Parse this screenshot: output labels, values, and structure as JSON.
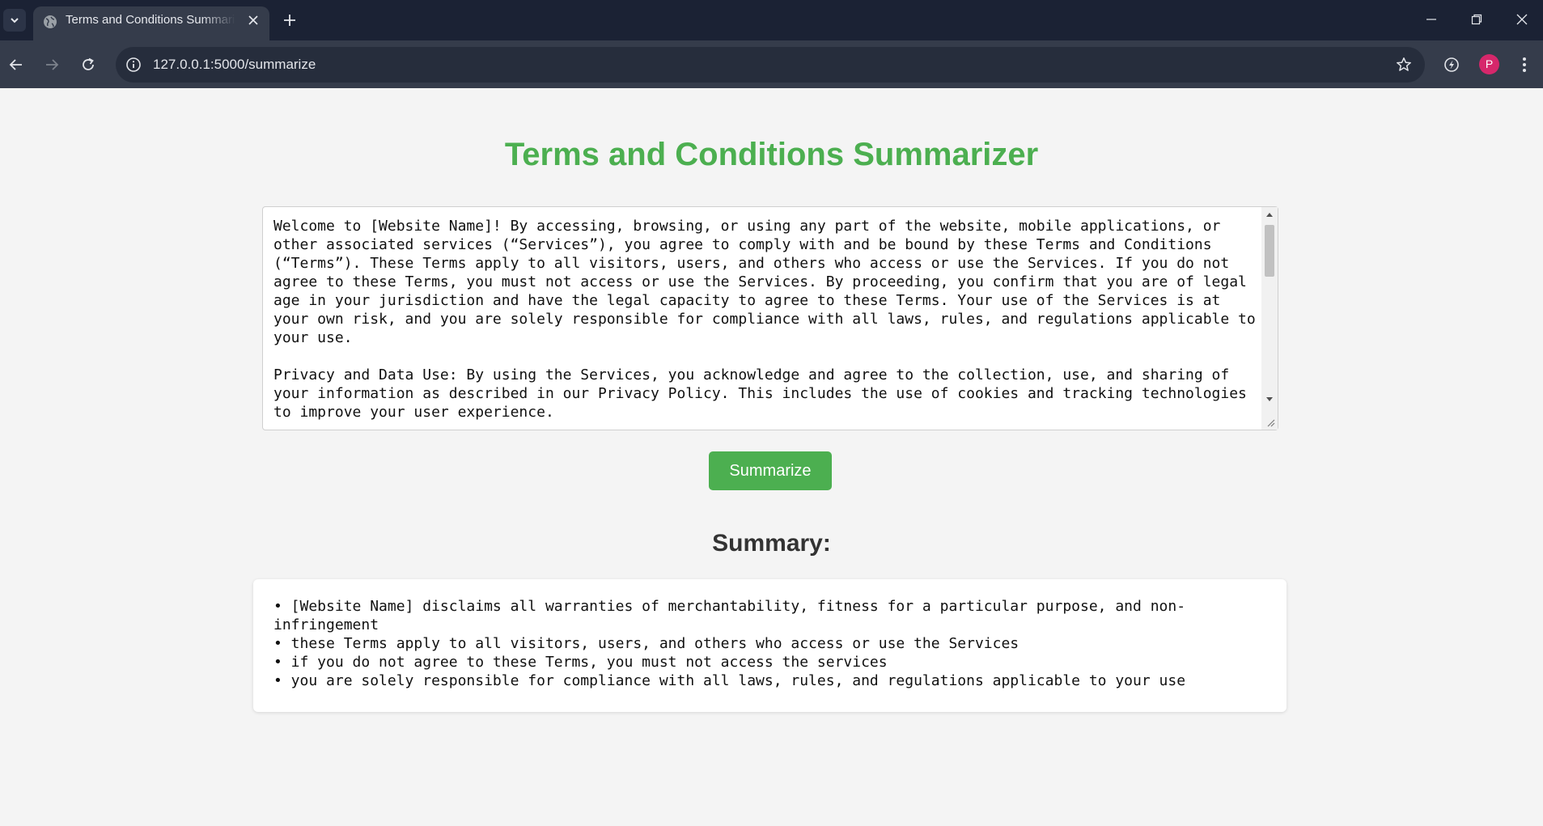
{
  "browser": {
    "tab_title": "Terms and Conditions Summarizer",
    "url": "127.0.0.1:5000/summarize",
    "profile_initial": "P"
  },
  "page": {
    "title": "Terms and Conditions Summarizer",
    "input_text": "Welcome to [Website Name]! By accessing, browsing, or using any part of the website, mobile applications, or other associated services (“Services”), you agree to comply with and be bound by these Terms and Conditions (“Terms”). These Terms apply to all visitors, users, and others who access or use the Services. If you do not agree to these Terms, you must not access or use the Services. By proceeding, you confirm that you are of legal age in your jurisdiction and have the legal capacity to agree to these Terms. Your use of the Services is at your own risk, and you are solely responsible for compliance with all laws, rules, and regulations applicable to your use.\n\nPrivacy and Data Use: By using the Services, you acknowledge and agree to the collection, use, and sharing of your information as described in our Privacy Policy. This includes the use of cookies and tracking technologies to improve your user experience.",
    "summarize_button": "Summarize",
    "summary_heading": "Summary:",
    "summary_bullets": [
      "• [Website Name] disclaims all warranties of merchantability, fitness for a particular purpose, and non-infringement",
      "• these Terms apply to all visitors, users, and others who access or use the Services",
      "• if you do not agree to these Terms, you must not access the services",
      "• you are solely responsible for compliance with all laws, rules, and regulations applicable to your use"
    ]
  },
  "colors": {
    "accent": "#4caf50",
    "chrome_dark": "#1b2234",
    "chrome_toolbar": "#353c4b",
    "avatar": "#d6276b"
  },
  "icons": [
    "tab-search-icon",
    "globe-icon",
    "close-icon",
    "plus-icon",
    "minimize-icon",
    "restore-icon",
    "window-close-icon",
    "back-icon",
    "forward-icon",
    "reload-icon",
    "site-info-icon",
    "bookmark-star-icon",
    "extension-icon",
    "kebab-menu-icon"
  ]
}
